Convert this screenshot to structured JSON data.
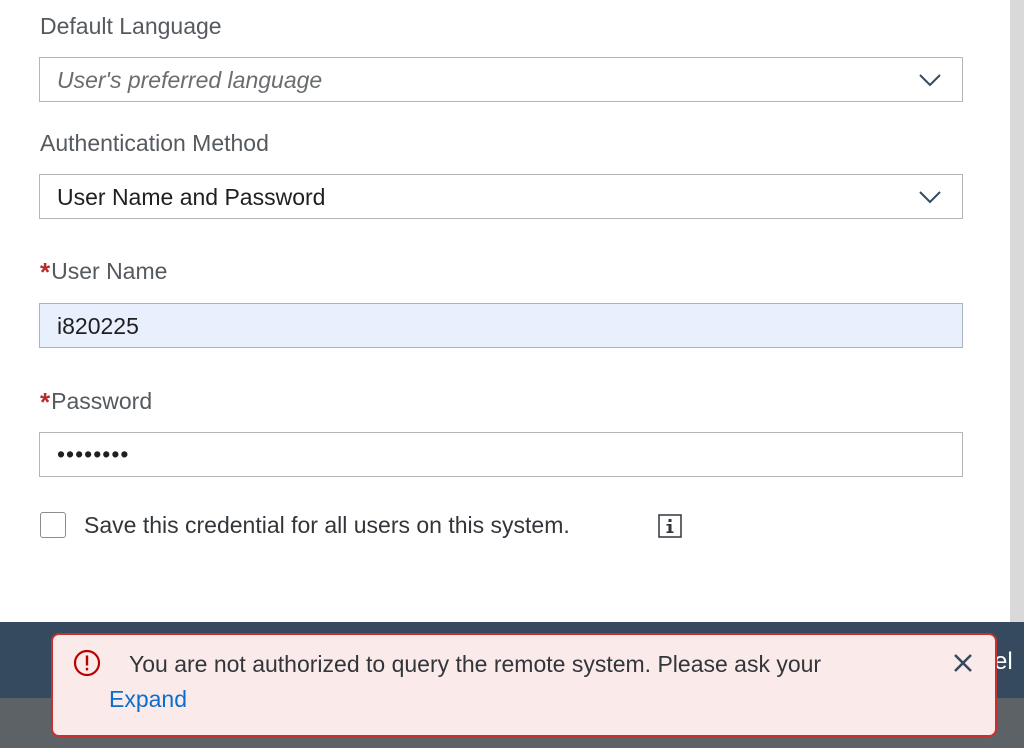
{
  "form": {
    "default_language": {
      "label": "Default Language",
      "placeholder": "User's preferred language",
      "value": ""
    },
    "auth_method": {
      "label": "Authentication Method",
      "value": "User Name and Password"
    },
    "username": {
      "required_marker": "*",
      "label": "User Name",
      "value": "i820225"
    },
    "password": {
      "required_marker": "*",
      "label": "Password",
      "masked_value": "••••••••"
    },
    "save_credential": {
      "label": "Save this credential for all users on this system.",
      "checked": false
    }
  },
  "footer": {
    "partial_text": "el"
  },
  "toast": {
    "message": "You are not authorized to query the remote system. Please ask your",
    "expand_label": "Expand",
    "accent_color": "#c8302f"
  },
  "icons": {
    "dropdown": "chevron-down-icon",
    "info": "info-icon",
    "error": "error-icon",
    "close": "close-icon"
  }
}
